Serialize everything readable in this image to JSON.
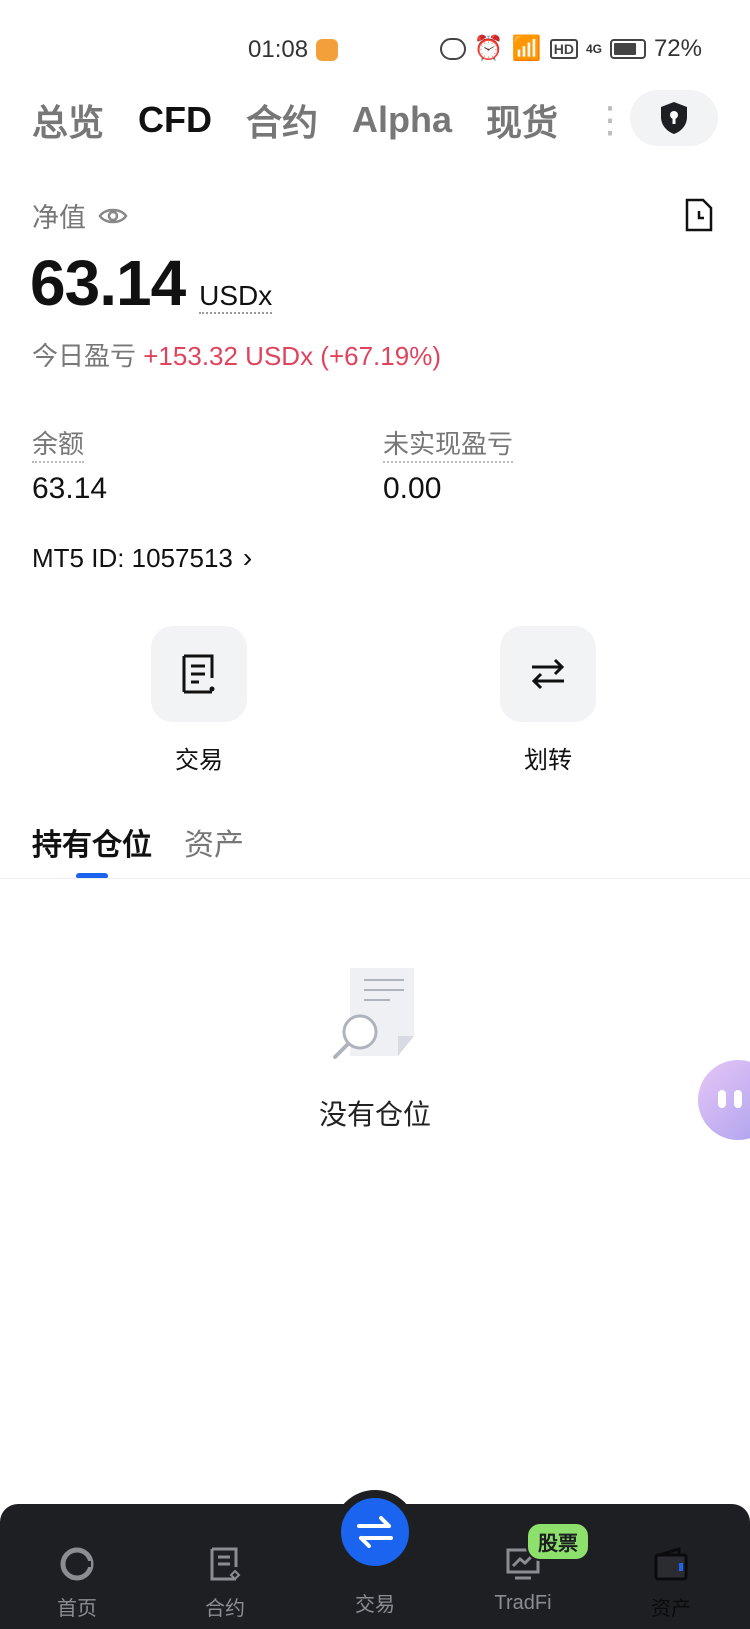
{
  "status_bar": {
    "time": "01:08",
    "battery": "72%",
    "hd": "HD",
    "net": "4G"
  },
  "top_tabs": [
    "总览",
    "CFD",
    "合约",
    "Alpha",
    "现货"
  ],
  "summary": {
    "net_value_label": "净值",
    "net_value": "63.14",
    "unit": "USDx",
    "today_pnl_label": "今日盈亏",
    "today_pnl_value": "+153.32 USDx (+67.19%)",
    "balance_label": "余额",
    "balance_value": "63.14",
    "unrealized_label": "未实现盈亏",
    "unrealized_value": "0.00",
    "mt5_id": "MT5 ID: 1057513"
  },
  "actions": {
    "trade": "交易",
    "transfer": "划转"
  },
  "sub_tabs": {
    "positions": "持有仓位",
    "assets": "资产"
  },
  "empty_state": "没有仓位",
  "bottom_nav": {
    "home": "首页",
    "futures": "合约",
    "trade": "交易",
    "tradfi": "TradFi",
    "assets": "资产",
    "badge": "股票"
  },
  "colors": {
    "accent": "#1a64f0",
    "loss_gain": "#e0445d",
    "nav_bg": "#1e1f22",
    "badge": "#8ce06b"
  }
}
